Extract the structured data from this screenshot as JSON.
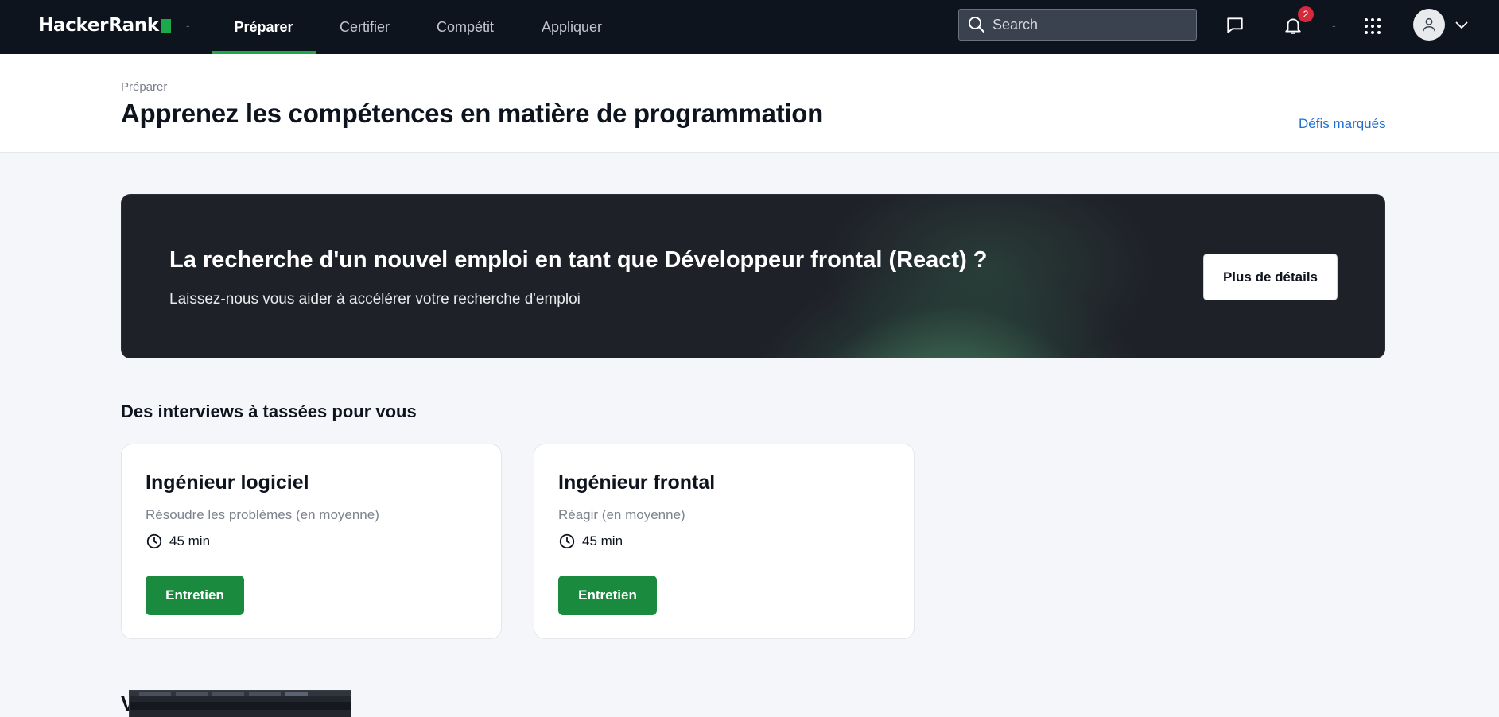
{
  "brand": {
    "name": "HackerRank",
    "accent": "#1ba94c"
  },
  "topnav": {
    "separator": "-",
    "tabs": [
      {
        "label": "Préparer",
        "active": true
      },
      {
        "label": "Certifier"
      },
      {
        "label": "Compétit"
      },
      {
        "label": "Appliquer"
      }
    ],
    "search": {
      "placeholder": "Search"
    },
    "notifications_count": "2"
  },
  "header": {
    "breadcrumb": "Préparer",
    "title": "Apprenez les compétences en matière de programmation",
    "link": "Défis marqués"
  },
  "banner": {
    "title": "La recherche d'un nouvel emploi en tant que Développeur frontal (React) ?",
    "subtitle": "Laissez-nous vous aider à accélérer votre recherche d'emploi",
    "button": "Plus de détails"
  },
  "interviews": {
    "title": "Des interviews à tassées pour vous",
    "cards": [
      {
        "title": "Ingénieur logiciel",
        "subtitle": "Résoudre les problèmes (en moyenne)",
        "duration": "45 min",
        "button": "Entretien"
      },
      {
        "title": "Ingénieur frontal",
        "subtitle": "Réagir (en moyenne)",
        "duration": "45 min",
        "button": "Entretien"
      }
    ]
  },
  "next_section": {
    "partial_letter": "V"
  }
}
